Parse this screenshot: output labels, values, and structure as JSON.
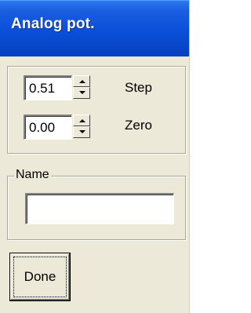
{
  "window": {
    "title": "Analog pot."
  },
  "settings": {
    "step": {
      "value": "0.51",
      "label": "Step"
    },
    "zero": {
      "value": "0.00",
      "label": "Zero"
    }
  },
  "name": {
    "legend": "Name",
    "value": ""
  },
  "buttons": {
    "done_label": "Done"
  }
}
